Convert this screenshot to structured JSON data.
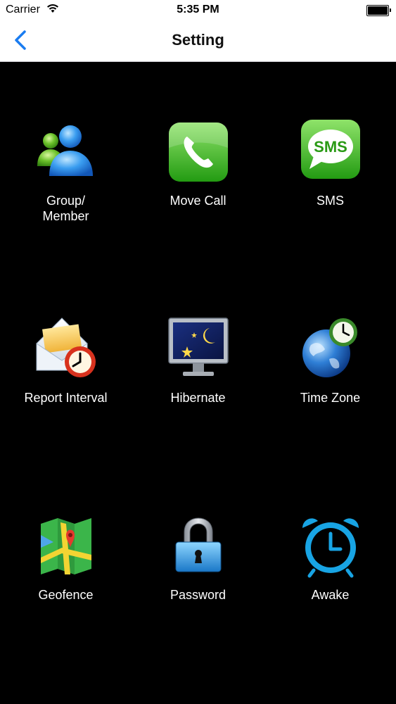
{
  "status_bar": {
    "carrier": "Carrier",
    "time": "5:35 PM"
  },
  "nav": {
    "title": "Setting",
    "back_icon": "chevron-left-icon",
    "accent_color": "#1a7cf0"
  },
  "grid": {
    "items": [
      {
        "label": "Group/\nMember",
        "icon": "group-member-icon"
      },
      {
        "label": "Move Call",
        "icon": "phone-icon"
      },
      {
        "label": "SMS",
        "icon": "sms-icon",
        "icon_text": "SMS"
      },
      {
        "label": "Report Interval",
        "icon": "mail-clock-icon"
      },
      {
        "label": "Hibernate",
        "icon": "monitor-night-icon"
      },
      {
        "label": "Time Zone",
        "icon": "globe-clock-icon"
      },
      {
        "label": "Geofence",
        "icon": "map-pin-icon"
      },
      {
        "label": "Password",
        "icon": "padlock-icon"
      },
      {
        "label": "Awake",
        "icon": "alarm-clock-icon"
      }
    ]
  }
}
